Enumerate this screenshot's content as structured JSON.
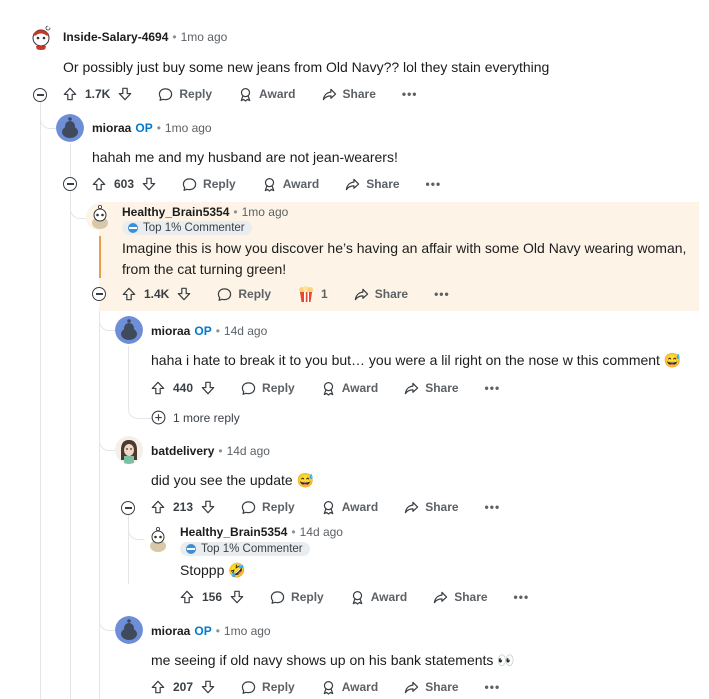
{
  "comments": [
    {
      "user": "Inside-Salary-4694",
      "op": "",
      "time": "1mo ago",
      "body": "Or possibly just buy some new jeans from Old Navy?? lol they stain everything",
      "votes": "1.7K"
    },
    {
      "user": "mioraa",
      "op": "OP",
      "time": "1mo ago",
      "body": "hahah me and my husband are not jean-wearers!",
      "votes": "603"
    },
    {
      "user": "Healthy_Brain5354",
      "op": "",
      "time": "1mo ago",
      "badge": "Top 1% Commenter",
      "body": "Imagine this is how you discover he’s having an affair with some Old Navy wearing woman, from the cat turning green!",
      "votes": "1.4K",
      "award_count": "1"
    },
    {
      "user": "mioraa",
      "op": "OP",
      "time": "14d ago",
      "body": "haha i hate to break it to you but… you were a lil right on the nose w this comment 😅",
      "votes": "440",
      "more_replies": "1 more reply"
    },
    {
      "user": "batdelivery",
      "op": "",
      "time": "14d ago",
      "body": "did you see the update 😅",
      "votes": "213"
    },
    {
      "user": "Healthy_Brain5354",
      "op": "",
      "time": "14d ago",
      "badge": "Top 1% Commenter",
      "body": "Stoppp 🤣",
      "votes": "156"
    },
    {
      "user": "mioraa",
      "op": "OP",
      "time": "1mo ago",
      "body": "me seeing if old navy shows up on his bank statements 👀",
      "votes": "207"
    }
  ],
  "labels": {
    "reply": "Reply",
    "award": "Award",
    "share": "Share",
    "more": "•••",
    "separator": "•"
  }
}
